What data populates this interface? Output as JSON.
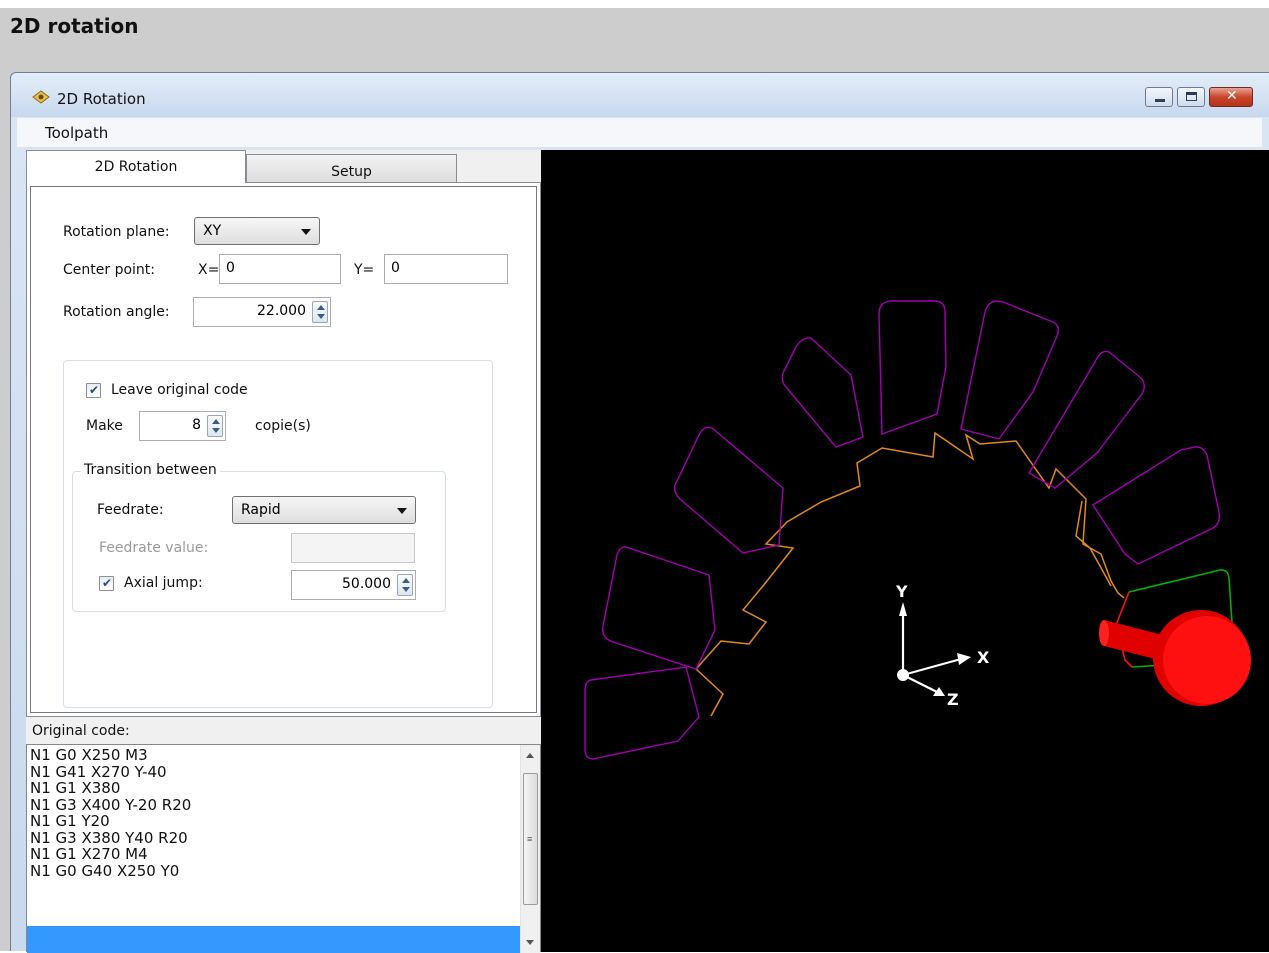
{
  "page": {
    "title": "2D rotation"
  },
  "window": {
    "title": "2D Rotation",
    "menu": [
      "Toolpath"
    ]
  },
  "tabs": {
    "active": "2D Rotation",
    "inactive": "Setup"
  },
  "form": {
    "rotation_plane_label": "Rotation plane:",
    "rotation_plane_value": "XY",
    "center_point_label": "Center point:",
    "x_label": "X=",
    "x_value": "0",
    "y_label": "Y=",
    "y_value": "0",
    "rotation_angle_label": "Rotation angle:",
    "rotation_angle_value": "22.000",
    "leave_original_label": "Leave original code",
    "leave_original_checked": true,
    "make_label": "Make",
    "make_value": "8",
    "copies_label": "copie(s)",
    "transition_title": "Transition between",
    "feedrate_label": "Feedrate:",
    "feedrate_value": "Rapid",
    "feedrate_value_label": "Feedrate value:",
    "feedrate_value_value": "",
    "axial_jump_label": "Axial jump:",
    "axial_jump_checked": true,
    "axial_jump_value": "50.000"
  },
  "code": {
    "label": "Original code:",
    "lines": [
      "N1 G0 X250 M3",
      "N1 G41 X270 Y-40",
      "N1 G1 X380",
      "N1 G3 X400 Y-20 R20",
      "N1 G1 Y20",
      "N1 G3 X380 Y40 R20",
      "N1 G1 X270 M4",
      "N1 G0 G40 X250 Y0"
    ]
  },
  "viewport": {
    "axis_labels": {
      "x": "X",
      "y": "Y",
      "z": "Z"
    },
    "colors": {
      "background": "#000000",
      "copies": "#a000b0",
      "rapid_moves": "#e08a1e",
      "original": "#00b000",
      "tool": "#ff1010",
      "axes": "#ffffff"
    }
  }
}
